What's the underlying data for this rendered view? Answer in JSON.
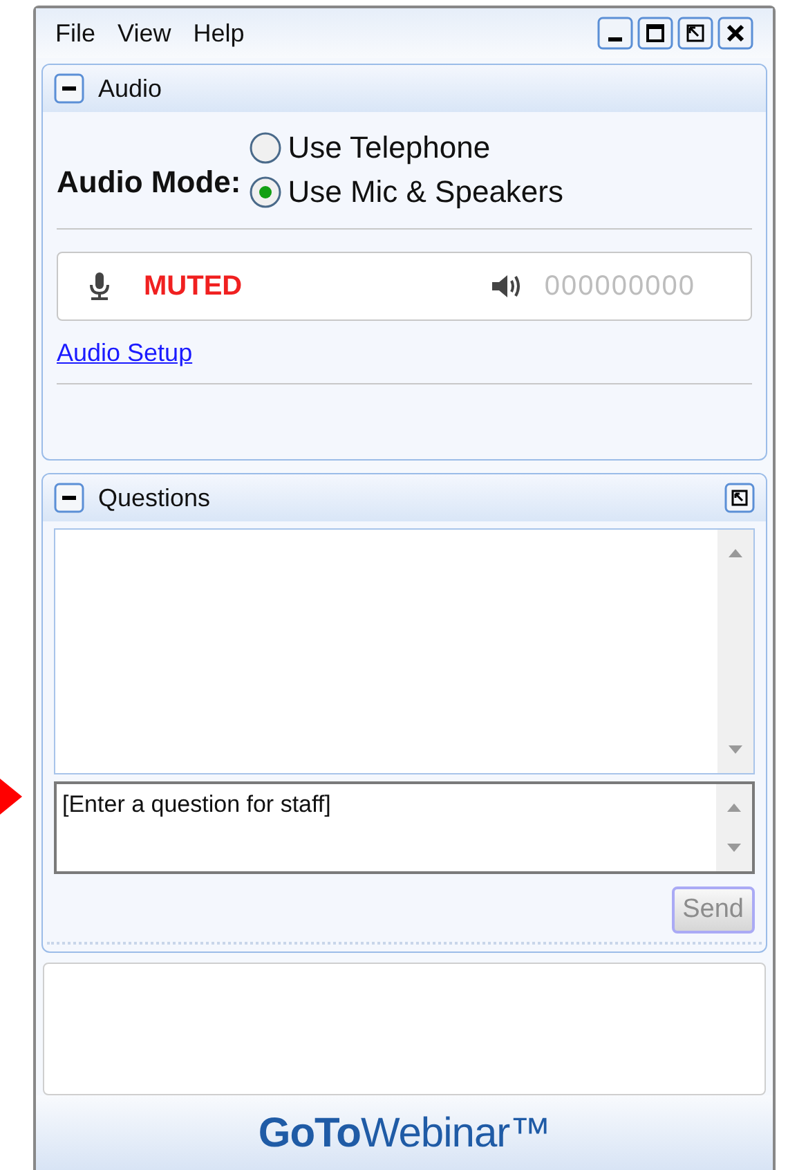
{
  "menu": [
    "File",
    "View",
    "Help"
  ],
  "audio_panel": {
    "title": "Audio",
    "expanded": true,
    "mode_label": "Audio Mode:",
    "options": [
      {
        "label": "Use Telephone",
        "selected": false
      },
      {
        "label": "Use Mic & Speakers",
        "selected": true
      }
    ],
    "status": "MUTED",
    "counter": "000000000",
    "setup_link": "Audio Setup"
  },
  "questions_panel": {
    "title": "Questions",
    "expanded": true,
    "input_placeholder": "[Enter a question for staff]",
    "send": {
      "label": "Send",
      "disabled": true
    }
  },
  "logo": "**GoTo**Webinar™"
}
